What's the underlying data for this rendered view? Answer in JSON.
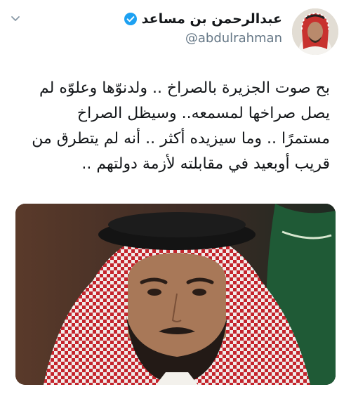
{
  "tweet": {
    "author": {
      "display_name": "عبدالرحمن بن مساعد",
      "handle": "@abdulrahman",
      "verified": true,
      "avatar": "profile-photo"
    },
    "menu_icon": "chevron-down-icon",
    "text_lines": [
      "بح صوت الجزيرة بالصراخ .. ولدنوّها وعلوّه لم",
      "يصل صراخها لمسمعه.. وسيظل الصراخ",
      "مستمرًا .. وما سيزيده أكثر .. أنه لم يتطرق من",
      "قريب أوبعيد في مقابلته لأزمة دولتهم .."
    ],
    "media": "photo"
  },
  "colors": {
    "text": "#14171a",
    "secondary": "#657786",
    "verified": "#1da1f2",
    "icon_gray": "#8899a6"
  }
}
